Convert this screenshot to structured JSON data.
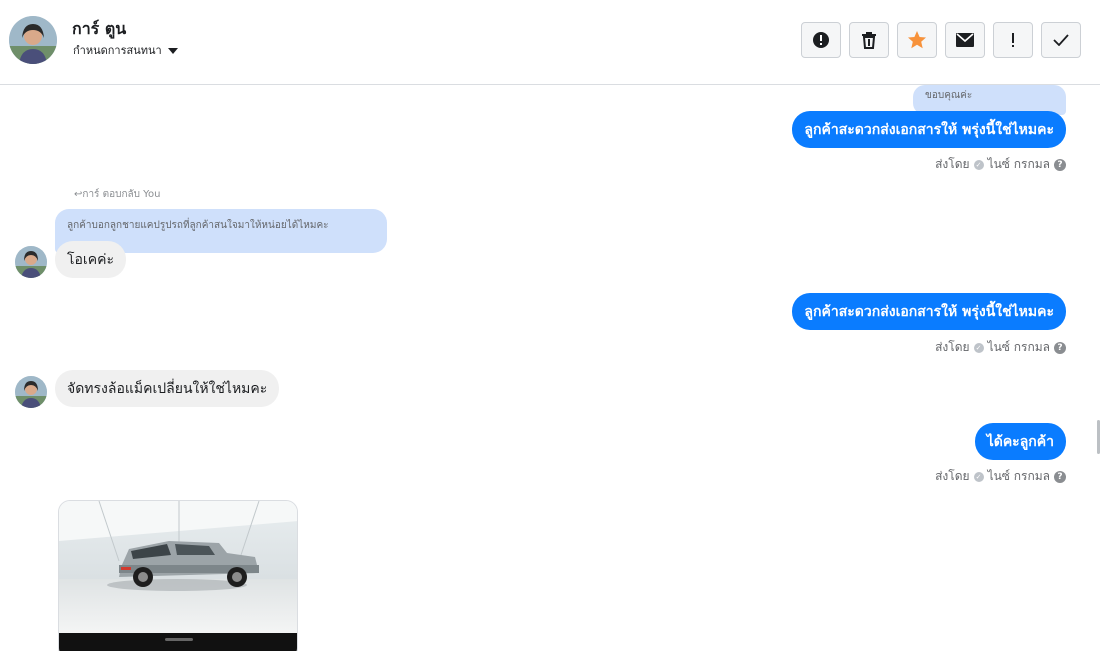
{
  "header": {
    "contact_name": "การ์ ตูน",
    "assign_label": "กำหนดการสนทนา",
    "actions": [
      {
        "name": "spam-button",
        "icon": "alert-circle-icon"
      },
      {
        "name": "delete-button",
        "icon": "trash-icon"
      },
      {
        "name": "star-button",
        "icon": "star-icon",
        "color": "#f7923b"
      },
      {
        "name": "mark-unread-button",
        "icon": "envelope-icon"
      },
      {
        "name": "follow-up-button",
        "icon": "exclamation-icon"
      },
      {
        "name": "mark-done-button",
        "icon": "checkmark-icon"
      }
    ]
  },
  "messages": {
    "quote_top": "ขอบคุณค่ะ",
    "out_1": "ลูกค้าสะดวกส่งเอกสารให้ พรุ่งนี้ใช่ไหมคะ",
    "replied_note": "การ์ ตอบกลับ You",
    "quote_in": "ลูกค้าบอกลูกชายแคปรูปรถที่ลูกค้าสนใจมาให้หน่อยได้ไหมคะ",
    "in_1": "โอเคค่ะ",
    "out_2": "ลูกค้าสะดวกส่งเอกสารให้ พรุ่งนี้ใช่ไหมคะ",
    "in_2": "จัดทรงล้อแม็คเปลี่ยนให้ใช่ไหมคะ",
    "out_3": "ได้คะลูกค้า",
    "sent_prefix": "ส่งโดย",
    "sent_name": "ไนซ์ กรกมล",
    "help_glyph": "?"
  },
  "colors": {
    "outgoing_bubble": "#0a7cff",
    "incoming_bubble": "#f0f0f0",
    "quote_bubble": "#cfe0fb"
  }
}
